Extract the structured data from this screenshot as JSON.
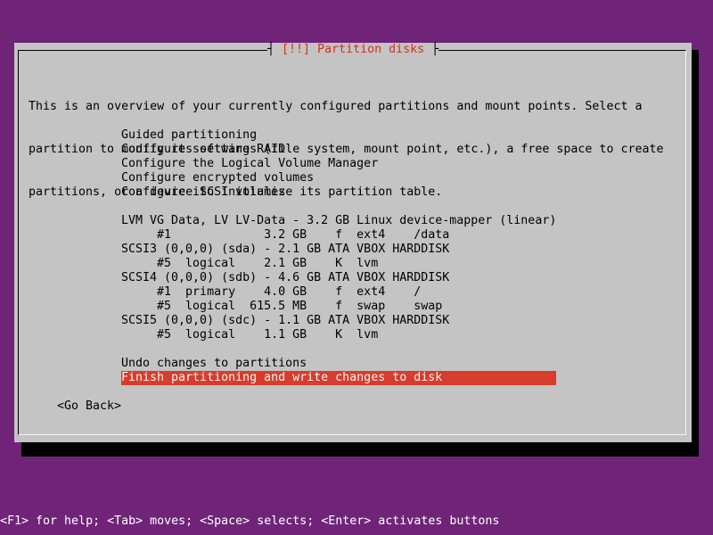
{
  "dialog": {
    "title": "[!!] Partition disks",
    "intro_lines": [
      "This is an overview of your currently configured partitions and mount points. Select a",
      "partition to modify its settings (file system, mount point, etc.), a free space to create",
      "partitions, or a device to initialize its partition table."
    ],
    "menu": [
      {
        "text": "Guided partitioning",
        "selected": false
      },
      {
        "text": "Configure software RAID",
        "selected": false
      },
      {
        "text": "Configure the Logical Volume Manager",
        "selected": false
      },
      {
        "text": "Configure encrypted volumes",
        "selected": false
      },
      {
        "text": "Configure iSCSI volumes",
        "selected": false
      },
      {
        "text": "",
        "selected": false
      },
      {
        "text": "LVM VG Data, LV LV-Data - 3.2 GB Linux device-mapper (linear)",
        "selected": false
      },
      {
        "text": "     #1             3.2 GB    f  ext4    /data",
        "selected": false
      },
      {
        "text": "SCSI3 (0,0,0) (sda) - 2.1 GB ATA VBOX HARDDISK",
        "selected": false
      },
      {
        "text": "     #5  logical    2.1 GB    K  lvm",
        "selected": false
      },
      {
        "text": "SCSI4 (0,0,0) (sdb) - 4.6 GB ATA VBOX HARDDISK",
        "selected": false
      },
      {
        "text": "     #1  primary    4.0 GB    f  ext4    /",
        "selected": false
      },
      {
        "text": "     #5  logical  615.5 MB    f  swap    swap",
        "selected": false
      },
      {
        "text": "SCSI5 (0,0,0) (sdc) - 1.1 GB ATA VBOX HARDDISK",
        "selected": false
      },
      {
        "text": "     #5  logical    1.1 GB    K  lvm",
        "selected": false
      },
      {
        "text": "",
        "selected": false
      },
      {
        "text": "Undo changes to partitions",
        "selected": false
      },
      {
        "text": "Finish partitioning and write changes to disk",
        "selected": true
      }
    ],
    "go_back_label": "<Go Back>"
  },
  "footer": {
    "help_text": "<F1> for help; <Tab> moves; <Space> selects; <Enter> activates buttons"
  },
  "colors": {
    "background": "#6f2478",
    "dialog": "#c4c4c4",
    "title": "#d03020",
    "highlight": "#d63d2c"
  }
}
